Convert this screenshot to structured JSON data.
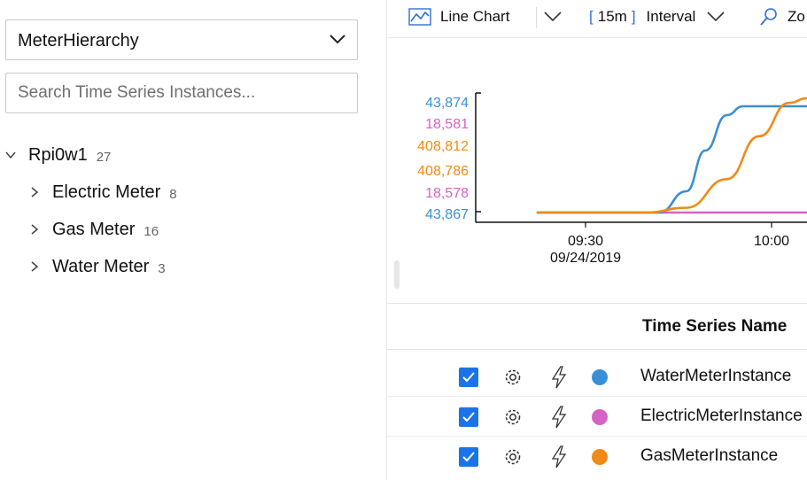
{
  "hierarchy_select": {
    "value": "MeterHierarchy"
  },
  "search": {
    "placeholder": "Search Time Series Instances..."
  },
  "tree": {
    "root": {
      "label": "Rpi0w1",
      "count": "27"
    },
    "children": [
      {
        "label": "Electric Meter",
        "count": "8"
      },
      {
        "label": "Gas Meter",
        "count": "16"
      },
      {
        "label": "Water Meter",
        "count": "3"
      }
    ]
  },
  "toolbar": {
    "chart_type": "Line Chart",
    "interval_open": "[",
    "interval_value": "15m",
    "interval_close": "]",
    "interval_label": "Interval",
    "zoom_label": "Zo"
  },
  "chart_data": {
    "type": "line",
    "y_ticks": [
      {
        "label": "43,874",
        "color": "#3b8fd6"
      },
      {
        "label": "18,581",
        "color": "#d563c6"
      },
      {
        "label": "408,812",
        "color": "#f08a16"
      },
      {
        "label": "408,786",
        "color": "#f08a16"
      },
      {
        "label": "18,578",
        "color": "#d563c6"
      },
      {
        "label": "43,867",
        "color": "#3b8fd6"
      }
    ],
    "x_ticks": [
      {
        "time": "09:30",
        "date": "09/24/2019"
      },
      {
        "time": "10:00",
        "date": ""
      }
    ],
    "series": [
      {
        "name": "WaterMeterInstance",
        "color": "#3b8fd6",
        "range": [
          43867,
          43874
        ],
        "points": [
          [
            0.0,
            43867
          ],
          [
            0.45,
            43867
          ],
          [
            0.55,
            43868.2
          ],
          [
            0.62,
            43870.5
          ],
          [
            0.7,
            43872.5
          ],
          [
            0.76,
            43873
          ],
          [
            1.0,
            43873
          ]
        ]
      },
      {
        "name": "ElectricMeterInstance",
        "color": "#d563c6",
        "range": [
          18578,
          18581
        ],
        "points": [
          [
            0.0,
            18578
          ],
          [
            1.0,
            18578
          ]
        ]
      },
      {
        "name": "GasMeterInstance",
        "color": "#f08a16",
        "range": [
          408786,
          408812
        ],
        "points": [
          [
            0.0,
            408786
          ],
          [
            0.4,
            408786
          ],
          [
            0.55,
            408787
          ],
          [
            0.7,
            408793
          ],
          [
            0.82,
            408802
          ],
          [
            0.93,
            408809
          ],
          [
            1.0,
            408810
          ]
        ]
      }
    ]
  },
  "table": {
    "header": "Time Series Name",
    "rows": [
      {
        "name": "WaterMeterInstance",
        "color": "#3b8fd6",
        "checked": true
      },
      {
        "name": "ElectricMeterInstance",
        "color": "#d563c6",
        "checked": true
      },
      {
        "name": "GasMeterInstance",
        "color": "#f08a16",
        "checked": true
      }
    ]
  }
}
